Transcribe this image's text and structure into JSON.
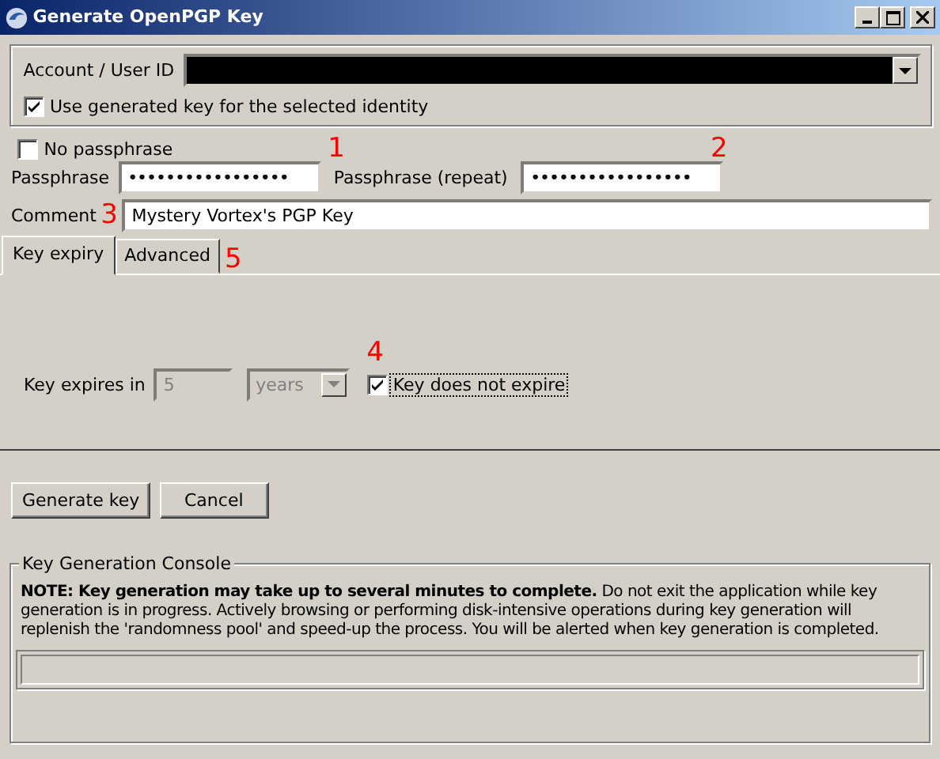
{
  "window": {
    "title": "Generate OpenPGP Key"
  },
  "account": {
    "label": "Account / User ID",
    "use_key": {
      "label": "Use generated key for the selected identity",
      "checked": true
    }
  },
  "no_passphrase": {
    "label": "No passphrase",
    "checked": false
  },
  "passphrase": {
    "label": "Passphrase",
    "value": "•••••••••••••••••"
  },
  "passphrase_repeat": {
    "label": "Passphrase (repeat)",
    "value": "•••••••••••••••••"
  },
  "comment": {
    "label": "Comment",
    "value": "Mystery Vortex's PGP Key"
  },
  "tabs": [
    {
      "label": "Key expiry",
      "selected": true
    },
    {
      "label": "Advanced",
      "selected": false
    }
  ],
  "expiry": {
    "label": "Key expires in",
    "amount": "5",
    "unit": "years",
    "never": {
      "label": "Key does not expire",
      "checked": true
    }
  },
  "buttons": [
    "Generate key",
    "Cancel"
  ],
  "console": {
    "title": "Key Generation Console",
    "note": "**NOTE: Key generation may take up to several minutes to complete.** Do not exit the application while key generation is in progress. Actively browsing or performing disk-intensive operations during key generation will replenish the 'randomness pool' and speed-up the process. You will be alerted when key generation is completed.",
    "progress": {
      "level": 0
    }
  },
  "annotations": [
    "1",
    "2",
    "3",
    "4",
    "5"
  ]
}
